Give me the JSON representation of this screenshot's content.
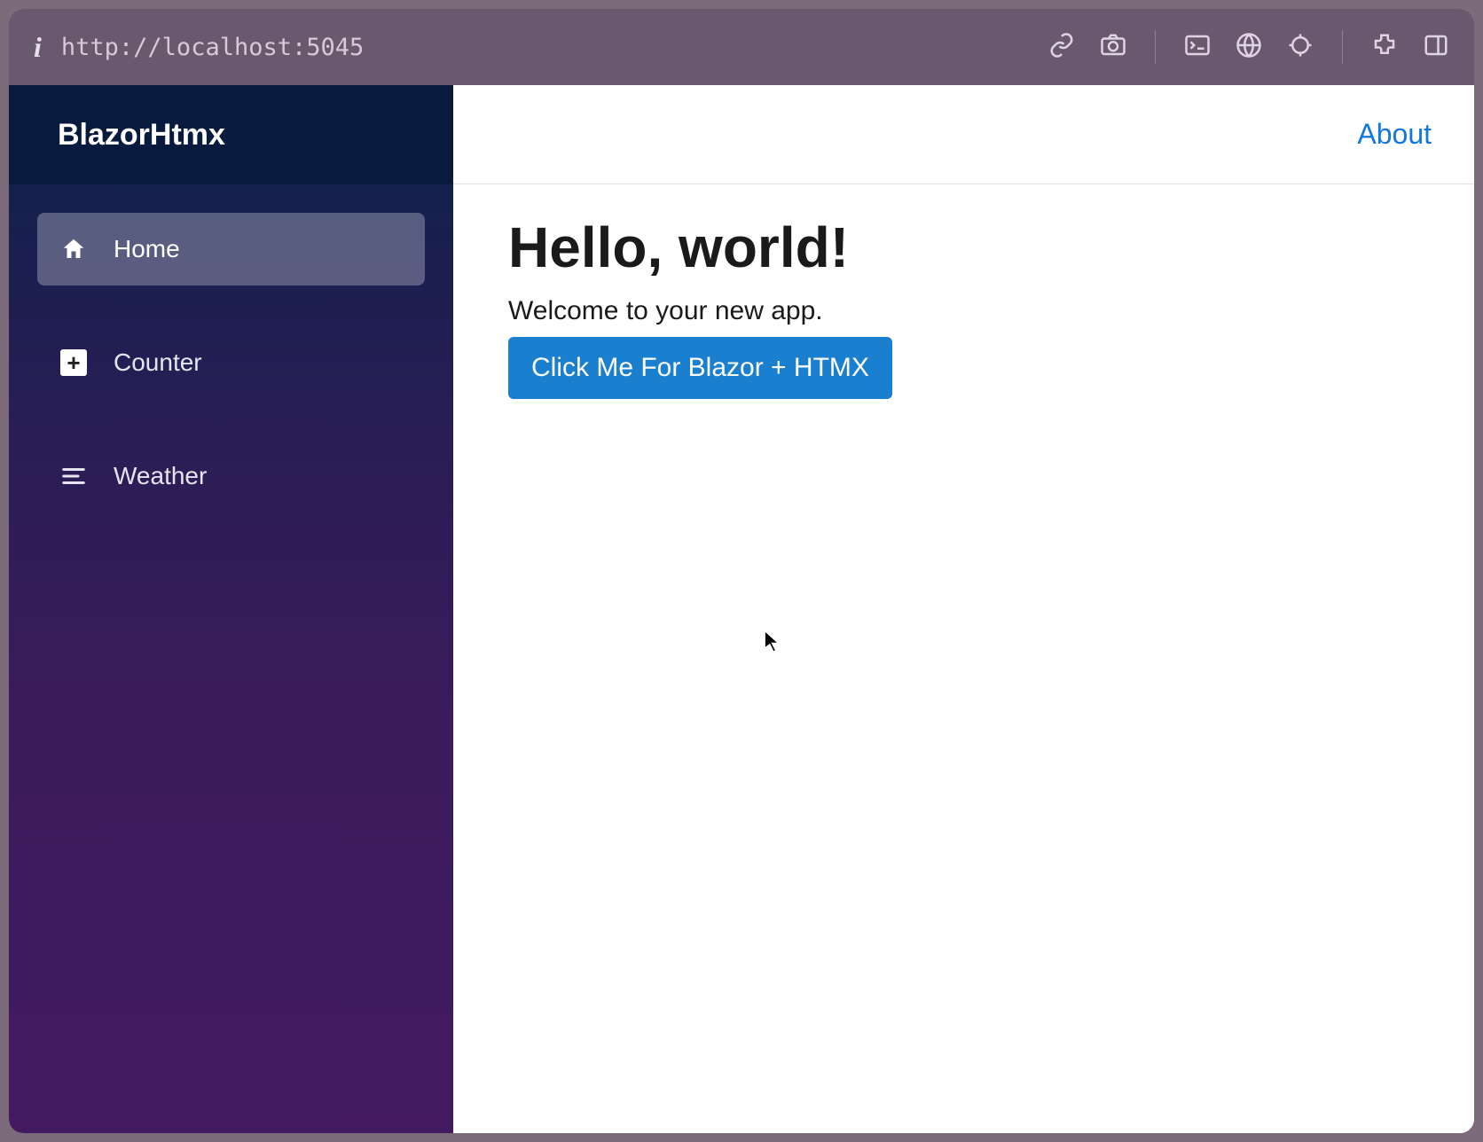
{
  "browser": {
    "url": "http://localhost:5045"
  },
  "sidebar": {
    "brand": "BlazorHtmx",
    "items": [
      {
        "label": "Home",
        "active": true
      },
      {
        "label": "Counter",
        "active": false
      },
      {
        "label": "Weather",
        "active": false
      }
    ]
  },
  "top_nav": {
    "about_label": "About"
  },
  "page": {
    "heading": "Hello, world!",
    "welcome": "Welcome to your new app.",
    "button_label": "Click Me For Blazor + HTMX"
  }
}
